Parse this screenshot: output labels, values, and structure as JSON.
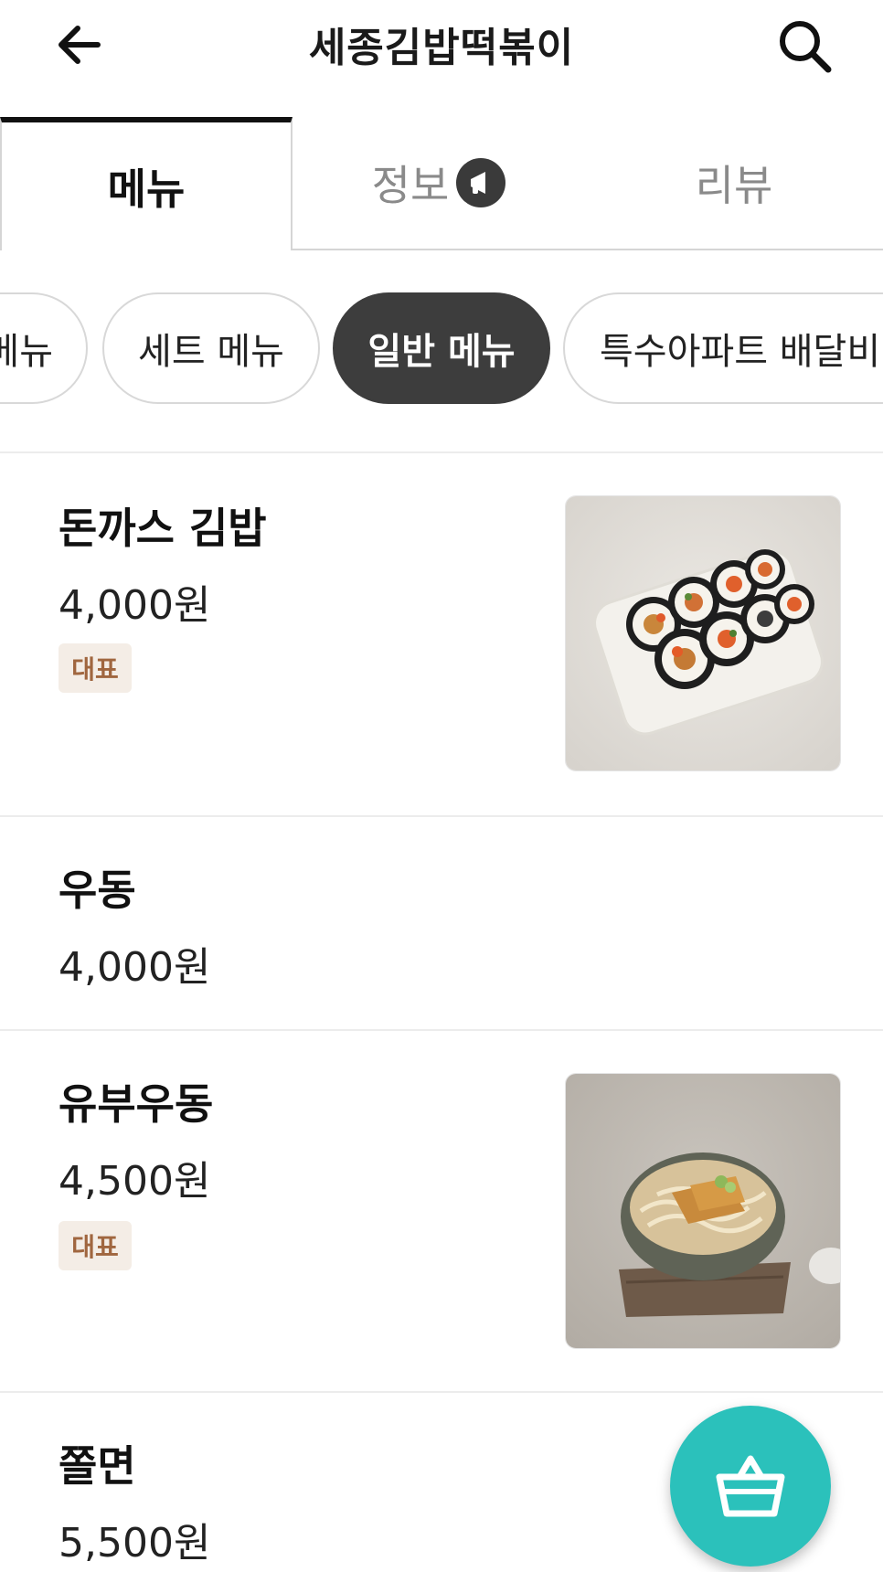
{
  "header": {
    "title": "세종김밥떡볶이",
    "back_icon": "arrow-left-icon",
    "search_icon": "search-icon"
  },
  "tabs": [
    {
      "label": "메뉴",
      "active": true
    },
    {
      "label": "정보",
      "active": false,
      "badge_icon": "megaphone-icon"
    },
    {
      "label": "리뷰",
      "active": false
    }
  ],
  "categories": [
    {
      "label": "메뉴",
      "active": false
    },
    {
      "label": "세트 메뉴",
      "active": false
    },
    {
      "label": "일반 메뉴",
      "active": true
    },
    {
      "label": "특수아파트 배달비",
      "active": false
    }
  ],
  "menu_items": [
    {
      "name": "돈까스 김밥",
      "price": "4,000원",
      "badge": "대표",
      "has_photo": true
    },
    {
      "name": "우동",
      "price": "4,000원",
      "has_photo": false
    },
    {
      "name": "유부우동",
      "price": "4,500원",
      "badge": "대표",
      "has_photo": true
    },
    {
      "name": "쫄면",
      "price": "5,500원",
      "has_photo": false
    }
  ],
  "cart": {
    "icon": "basket-icon"
  },
  "colors": {
    "accent": "#2bc1bb",
    "active_chip": "#3d3d3d",
    "badge_bg": "#f4ede6",
    "badge_text": "#a0663f"
  }
}
